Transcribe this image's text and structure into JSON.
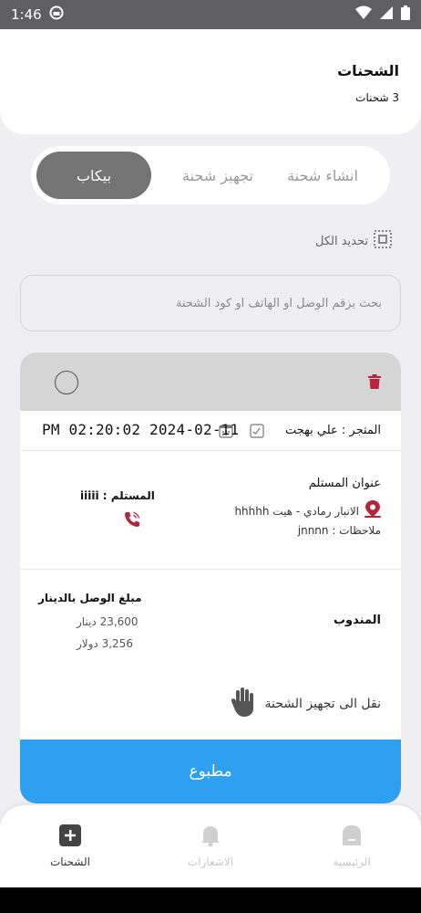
{
  "status_bar": {
    "time": "1:46"
  },
  "header": {
    "title": "الشحنات",
    "count": "3 شحنات"
  },
  "tabs": [
    {
      "label": "انشاء شحنة",
      "active": false
    },
    {
      "label": "تجهيز شحنة",
      "active": false
    },
    {
      "label": "بيكاب",
      "active": true
    }
  ],
  "select_all_label": "تحديد الكل",
  "search": {
    "placeholder": "بحث برقم الوصل او الهاتف او كود الشحنة"
  },
  "shipment": {
    "store": "المتجر : علي بهجت",
    "datetime": "PM 02:20:02 2024-02-11",
    "address_title": "عنوان المستلم",
    "address": "الانبار رمادي - هيت hhhhh",
    "notes": "ملاحظات : jnnnn",
    "recipient": "المستلم : iiiii",
    "amount_title": "مبلغ الوصل بالدينار",
    "amount_iqd": "23,600 دينار",
    "amount_usd": "3,256 دولار",
    "delegate_label": "المندوب",
    "move_label": "نقل الى تجهيز الشحنة",
    "print_label": "مطبوع"
  },
  "bottom_nav": [
    {
      "label": "الرئيسية",
      "active": false
    },
    {
      "label": "الاشعارات",
      "active": false
    },
    {
      "label": "الشحنات",
      "active": true
    }
  ],
  "colors": {
    "accent": "#2ea0ef",
    "danger": "#b5243a",
    "tab_active": "#747474"
  }
}
